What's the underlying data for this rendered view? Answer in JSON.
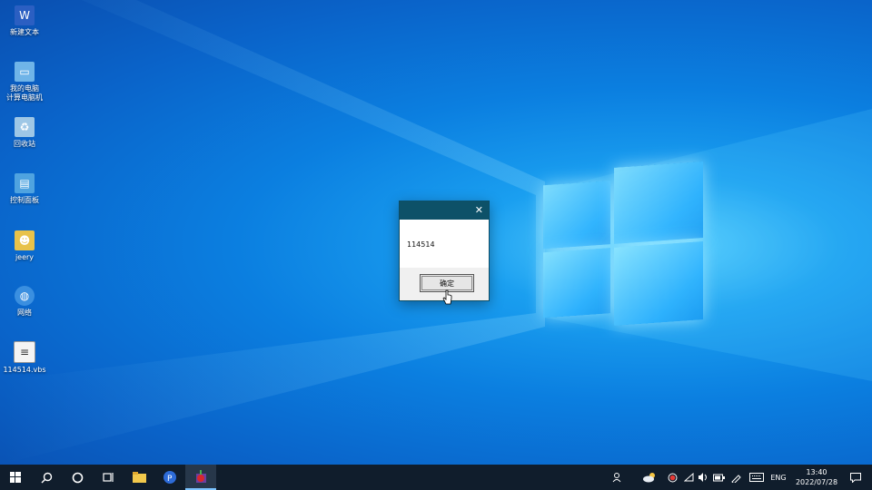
{
  "desktop": {
    "icons": [
      {
        "label": "新建文本",
        "icon": "word-document-icon",
        "color": "#2b5fc2"
      },
      {
        "label": "我的电脑\n计算电脑机",
        "icon": "computer-icon",
        "color": "#6fb4e8"
      },
      {
        "label": "回收站",
        "icon": "recycle-bin-icon",
        "color": "#9ec7e6"
      },
      {
        "label": "控制面板",
        "icon": "control-panel-icon",
        "color": "#4fa3e0"
      },
      {
        "label": "jeery",
        "icon": "user-folder-icon",
        "color": "#e8c24a"
      },
      {
        "label": "网络",
        "icon": "network-icon",
        "color": "#3a8fe0"
      },
      {
        "label": "114514.vbs",
        "icon": "script-file-icon",
        "color": "#f4f4f4"
      }
    ]
  },
  "dialog": {
    "close_glyph": "✕",
    "message": "114514",
    "ok_label": "确定"
  },
  "taskbar": {
    "tray_language": "ENG",
    "clock_time": "13:40",
    "clock_date": "2022/07/28"
  },
  "colors": {
    "taskbar_bg": "#101d2c",
    "dialog_titlebar": "#0d5168",
    "desktop_blue": "#0b7fe0"
  }
}
